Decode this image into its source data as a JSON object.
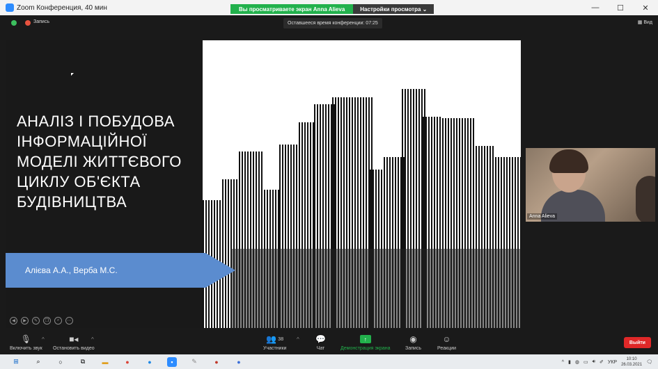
{
  "window": {
    "title": "Zoom Конференция, 40 мин",
    "share_notice": "Вы просматриваете экран Anna Alieva",
    "view_options": "Настройки просмотра ⌄"
  },
  "meeting": {
    "record_label": "Запись",
    "remaining_time": "Оставшееся время конференции: 07:25",
    "view_label": "Вид"
  },
  "slide": {
    "title": "АНАЛІЗ І ПОБУДОВА\nІНФОРМАЦІЙНОЇ\nМОДЕЛІ ЖИТТЄВОГО\nЦИКЛУ ОБ'ЄКТА\nБУДІВНИЦТВА",
    "authors": "Алієва А.А., Верба М.С."
  },
  "video": {
    "participant_name": "Anna Alieva"
  },
  "toolbar": {
    "mute_label": "Включить звук",
    "video_label": "Остановить видео",
    "participants_label": "Участники",
    "participants_count": "38",
    "chat_label": "Чат",
    "share_label": "Демонстрация экрана",
    "record_label": "Запись",
    "reactions_label": "Реакции",
    "leave_label": "Выйти"
  },
  "taskbar": {
    "language": "УКР",
    "time": "10:10",
    "date": "26.03.2021"
  },
  "colors": {
    "share_green": "#22b14c",
    "leave_red": "#e02828",
    "authors_banner": "#5b8ccf"
  }
}
